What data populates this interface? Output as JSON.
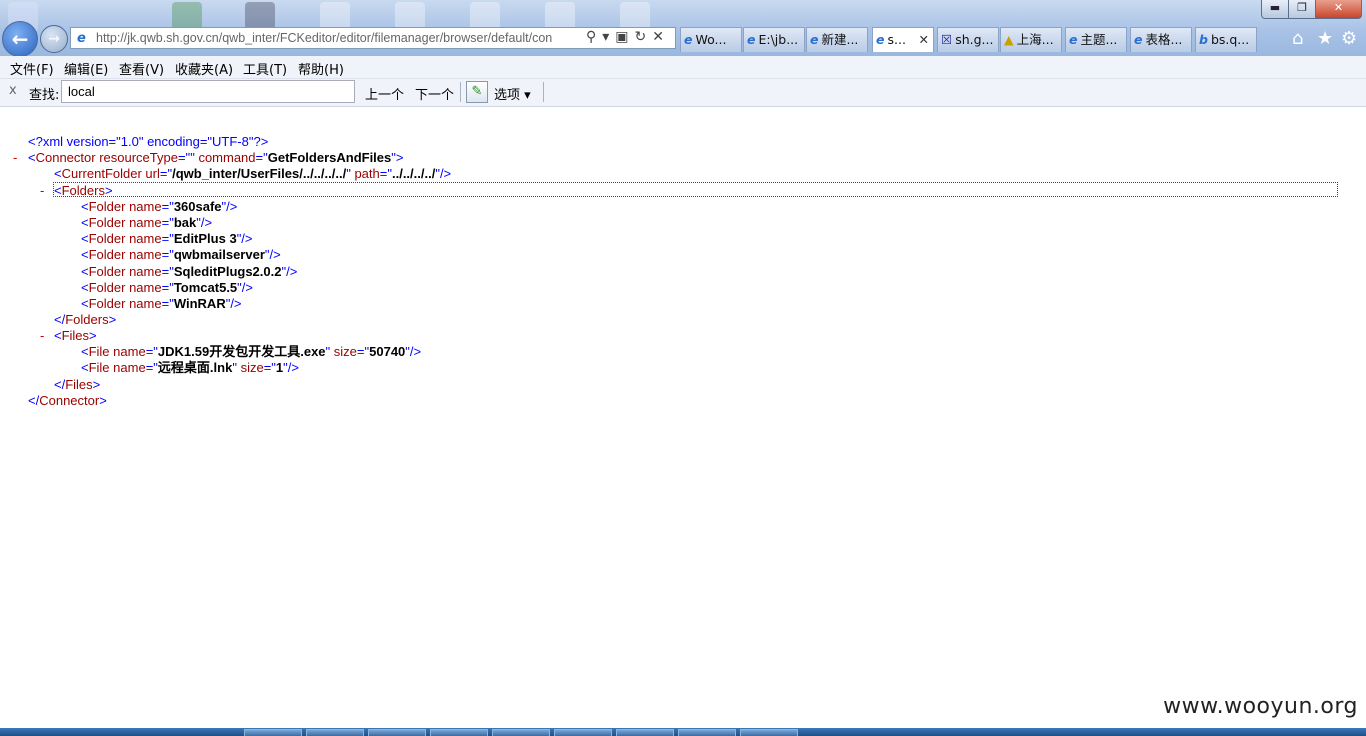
{
  "window_controls": {
    "minimize": "▬",
    "maximize": "❐",
    "close": "✕"
  },
  "nav": {
    "back_icon": "back-arrow-icon",
    "forward_icon": "forward-arrow-icon"
  },
  "address_bar": {
    "url": "http://jk.qwb.sh.gov.cn/qwb_inter/FCKeditor/editor/filemanager/browser/default/con",
    "icons": [
      "search-icon",
      "compat-view-icon",
      "refresh-icon",
      "stop-icon"
    ]
  },
  "tabs": [
    {
      "label": "Wo...",
      "favicon": "e",
      "active": false
    },
    {
      "label": "E:\\jb...",
      "favicon": "e",
      "active": false
    },
    {
      "label": "新建...",
      "favicon": "e",
      "active": false
    },
    {
      "label": "s...",
      "favicon": "e",
      "active": true,
      "close": "✕"
    },
    {
      "label": "sh.g...",
      "favicon": "☒",
      "active": false
    },
    {
      "label": "上海...",
      "favicon": "▲",
      "active": false
    },
    {
      "label": "主题...",
      "favicon": "e",
      "active": false
    },
    {
      "label": "表格...",
      "favicon": "e",
      "active": false
    },
    {
      "label": "bs.q...",
      "favicon": "b",
      "active": false
    }
  ],
  "toolbar_icons": {
    "home": "⌂",
    "favorites": "★",
    "tools": "⚙"
  },
  "menu": [
    "文件(F)",
    "编辑(E)",
    "查看(V)",
    "收藏夹(A)",
    "工具(T)",
    "帮助(H)"
  ],
  "find_bar": {
    "close": "x",
    "label": "查找:",
    "value": "local",
    "prev": "上一个",
    "next": "下一个",
    "options": "选项 ▾"
  },
  "xml": {
    "decl": "<?xml version=\"1.0\" encoding=\"UTF-8\"?>",
    "collapse_marker": "-",
    "connector": {
      "resourceType": "",
      "command": "GetFoldersAndFiles"
    },
    "current_folder": {
      "url": "/qwb_inter/UserFiles/../../../../",
      "path": "../../../../"
    },
    "folders": [
      "360safe",
      "bak",
      "EditPlus 3",
      "qwbmailserver",
      "SqleditPlugs2.0.2",
      "Tomcat5.5",
      "WinRAR"
    ],
    "files": [
      {
        "name": "JDK1.59开发包开发工具.exe",
        "size": "50740"
      },
      {
        "name": "远程桌面.lnk",
        "size": "1"
      }
    ]
  },
  "watermark": "www.wooyun.org"
}
